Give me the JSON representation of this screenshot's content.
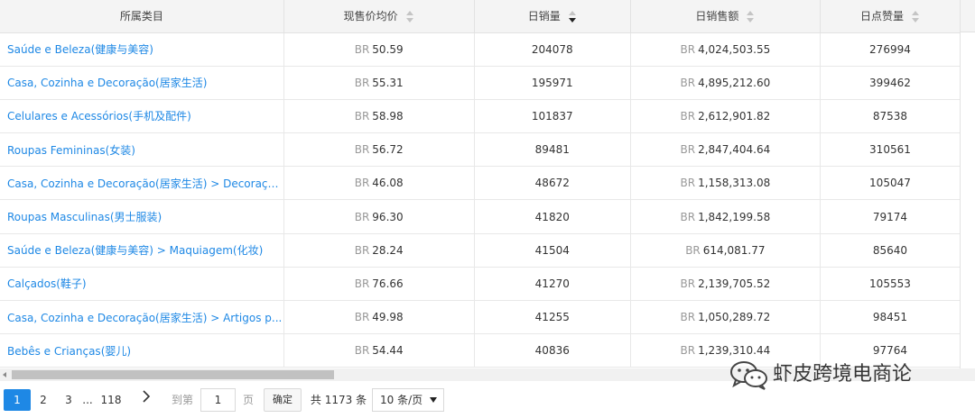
{
  "table": {
    "headers": [
      {
        "label": "所属类目",
        "sortable": false
      },
      {
        "label": "现售价均价",
        "sortable": true,
        "sort": "none"
      },
      {
        "label": "日销量",
        "sortable": true,
        "sort": "desc"
      },
      {
        "label": "日销售额",
        "sortable": true,
        "sort": "none"
      },
      {
        "label": "日点赞量",
        "sortable": true,
        "sort": "none"
      }
    ],
    "currency": "BR",
    "rows": [
      {
        "category": "Saúde e Beleza(健康与美容)",
        "avg_price": "50.59",
        "daily_sales": "204078",
        "daily_revenue": "4,024,503.55",
        "daily_likes": "276994"
      },
      {
        "category": "Casa, Cozinha e Decoração(居家生活)",
        "avg_price": "55.31",
        "daily_sales": "195971",
        "daily_revenue": "4,895,212.60",
        "daily_likes": "399462"
      },
      {
        "category": "Celulares e Acessórios(手机及配件)",
        "avg_price": "58.98",
        "daily_sales": "101837",
        "daily_revenue": "2,612,901.82",
        "daily_likes": "87538"
      },
      {
        "category": "Roupas Femininas(女装)",
        "avg_price": "56.72",
        "daily_sales": "89481",
        "daily_revenue": "2,847,404.64",
        "daily_likes": "310561"
      },
      {
        "category": "Casa, Cozinha e Decoração(居家生活) > Decoraçã...",
        "avg_price": "46.08",
        "daily_sales": "48672",
        "daily_revenue": "1,158,313.08",
        "daily_likes": "105047"
      },
      {
        "category": "Roupas Masculinas(男士服装)",
        "avg_price": "96.30",
        "daily_sales": "41820",
        "daily_revenue": "1,842,199.58",
        "daily_likes": "79174"
      },
      {
        "category": "Saúde e Beleza(健康与美容) > Maquiagem(化妆)",
        "avg_price": "28.24",
        "daily_sales": "41504",
        "daily_revenue": "614,081.77",
        "daily_likes": "85640"
      },
      {
        "category": "Calçados(鞋子)",
        "avg_price": "76.66",
        "daily_sales": "41270",
        "daily_revenue": "2,139,705.52",
        "daily_likes": "105553"
      },
      {
        "category": "Casa, Cozinha e Decoração(居家生活) > Artigos p...",
        "avg_price": "49.98",
        "daily_sales": "41255",
        "daily_revenue": "1,050,289.72",
        "daily_likes": "98451"
      },
      {
        "category": "Bebês e Crianças(婴儿)",
        "avg_price": "54.44",
        "daily_sales": "40836",
        "daily_revenue": "1,239,310.44",
        "daily_likes": "97764"
      }
    ]
  },
  "pagination": {
    "current_page": "1",
    "page_2": "2",
    "page_3": "3",
    "ellipsis": "...",
    "last_page": "118",
    "next_icon": "chevron-right-icon",
    "goto_label": "到第",
    "goto_value": "1",
    "page_label": "页",
    "confirm_label": "确定",
    "total_text": "共 1173 条",
    "page_size": "10 条/页"
  },
  "watermark": {
    "icon": "wechat-icon",
    "text": "虾皮跨境电商论"
  },
  "colors": {
    "link": "#1e88e5",
    "header_bg": "#f4f4f4",
    "active_page": "#1e88e5"
  }
}
